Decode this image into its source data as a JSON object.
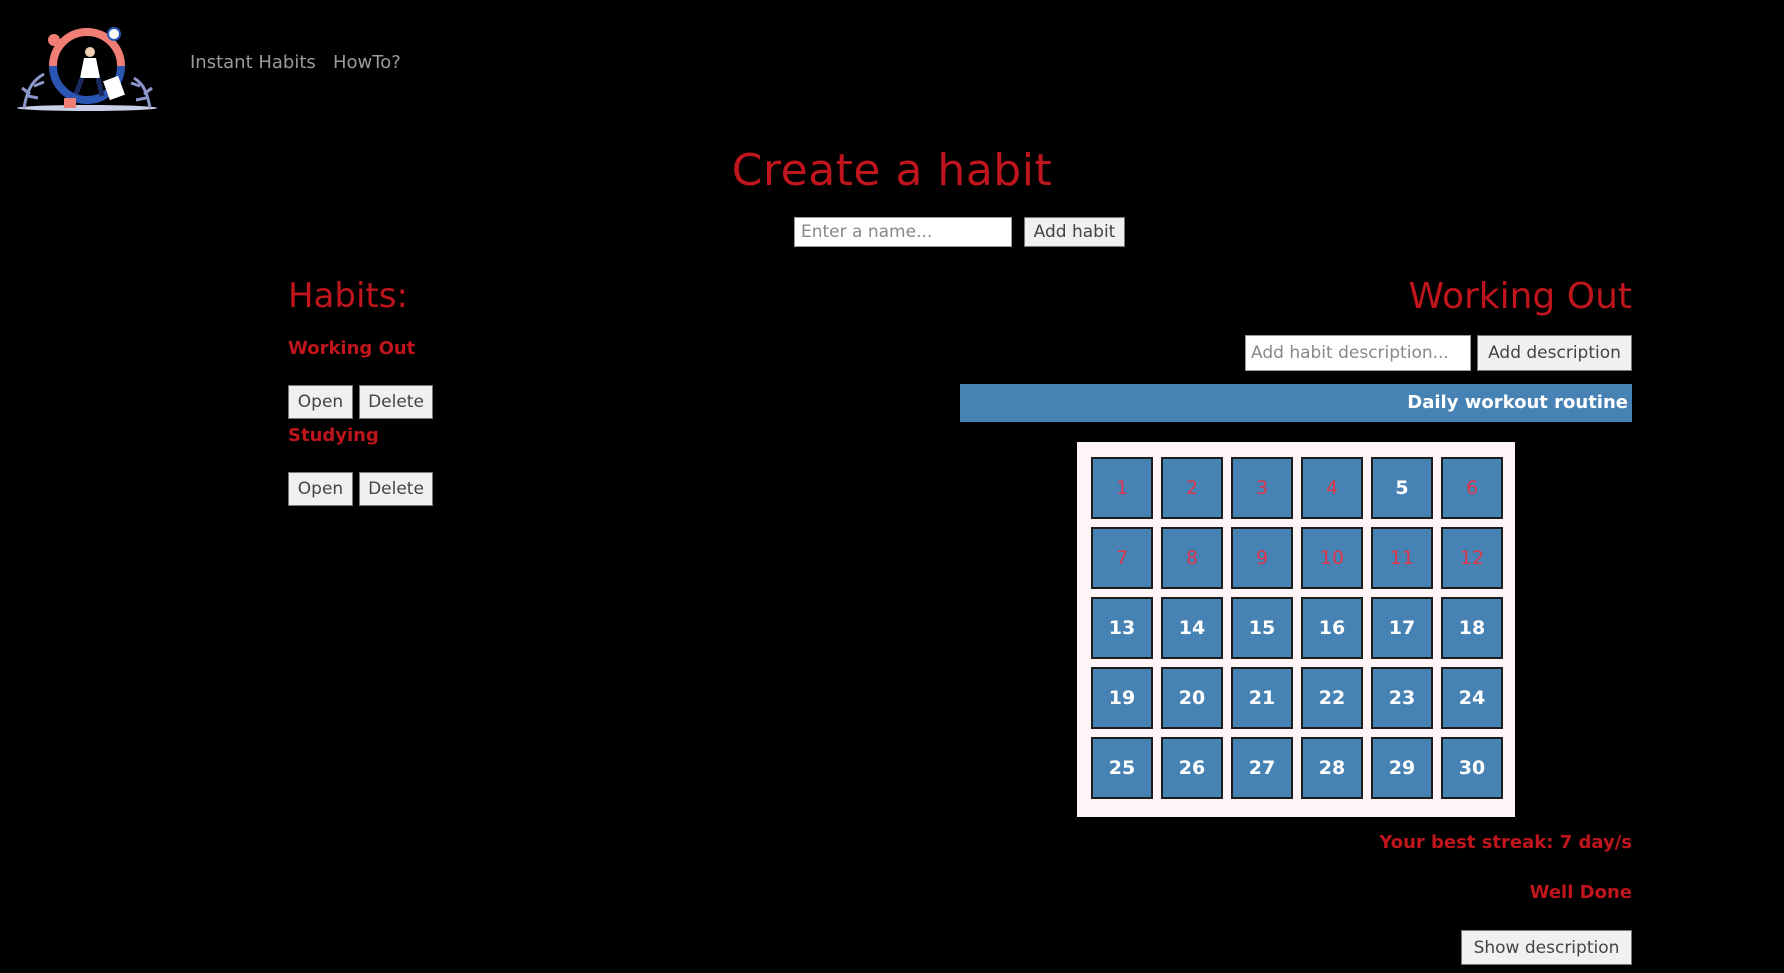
{
  "nav": {
    "logo_name": "habit-cycle-logo",
    "links": [
      "Instant Habits",
      "HowTo?"
    ]
  },
  "create": {
    "title": "Create a habit",
    "name_placeholder": "Enter a name...",
    "add_label": "Add habit"
  },
  "habits": {
    "heading": "Habits:",
    "items": [
      {
        "name": "Working Out",
        "open_label": "Open",
        "delete_label": "Delete"
      },
      {
        "name": "Studying",
        "open_label": "Open",
        "delete_label": "Delete"
      }
    ]
  },
  "detail": {
    "title": "Working Out",
    "desc_placeholder": "Add habit description...",
    "add_desc_label": "Add description",
    "description": "Daily workout routine",
    "days": [
      {
        "n": "1",
        "done": true
      },
      {
        "n": "2",
        "done": true
      },
      {
        "n": "3",
        "done": true
      },
      {
        "n": "4",
        "done": true
      },
      {
        "n": "5",
        "done": false
      },
      {
        "n": "6",
        "done": true
      },
      {
        "n": "7",
        "done": true
      },
      {
        "n": "8",
        "done": true
      },
      {
        "n": "9",
        "done": true
      },
      {
        "n": "10",
        "done": true
      },
      {
        "n": "11",
        "done": true
      },
      {
        "n": "12",
        "done": true
      },
      {
        "n": "13",
        "done": false
      },
      {
        "n": "14",
        "done": false
      },
      {
        "n": "15",
        "done": false
      },
      {
        "n": "16",
        "done": false
      },
      {
        "n": "17",
        "done": false
      },
      {
        "n": "18",
        "done": false
      },
      {
        "n": "19",
        "done": false
      },
      {
        "n": "20",
        "done": false
      },
      {
        "n": "21",
        "done": false
      },
      {
        "n": "22",
        "done": false
      },
      {
        "n": "23",
        "done": false
      },
      {
        "n": "24",
        "done": false
      },
      {
        "n": "25",
        "done": false
      },
      {
        "n": "26",
        "done": false
      },
      {
        "n": "27",
        "done": false
      },
      {
        "n": "28",
        "done": false
      },
      {
        "n": "29",
        "done": false
      },
      {
        "n": "30",
        "done": false
      }
    ],
    "streak_text": "Your best streak: 7 day/s",
    "well_done": "Well Done",
    "show_desc_label": "Show description"
  },
  "colors": {
    "accent_red": "#c0151c",
    "day_blue": "#4682b4",
    "done_text": "#e0354a",
    "background": "#000000"
  }
}
